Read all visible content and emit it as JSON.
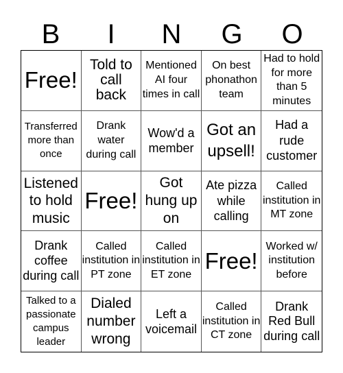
{
  "header": {
    "letters": [
      "B",
      "I",
      "N",
      "G",
      "O"
    ]
  },
  "cells": [
    {
      "text": "Free!",
      "free": true
    },
    {
      "text": "Told to call back"
    },
    {
      "text": "Mentioned AI four times in call"
    },
    {
      "text": "On best phonathon team"
    },
    {
      "text": "Had to hold for more than 5 minutes"
    },
    {
      "text": "Transferred more than once"
    },
    {
      "text": "Drank water during call"
    },
    {
      "text": "Wow'd a member"
    },
    {
      "text": "Got an upsell!"
    },
    {
      "text": "Had a rude customer"
    },
    {
      "text": "Listened to hold music"
    },
    {
      "text": "Free!",
      "free": true
    },
    {
      "text": "Got hung up on"
    },
    {
      "text": "Ate pizza while calling"
    },
    {
      "text": "Called institution in MT zone"
    },
    {
      "text": "Drank coffee during call"
    },
    {
      "text": "Called institution in PT zone"
    },
    {
      "text": "Called institution in ET zone"
    },
    {
      "text": "Free!",
      "free": true
    },
    {
      "text": "Worked w/ institution before"
    },
    {
      "text": "Talked to a passionate campus leader"
    },
    {
      "text": "Dialed number wrong"
    },
    {
      "text": "Left a voicemail"
    },
    {
      "text": "Called institution in CT zone"
    },
    {
      "text": "Drank Red Bull during call"
    }
  ]
}
